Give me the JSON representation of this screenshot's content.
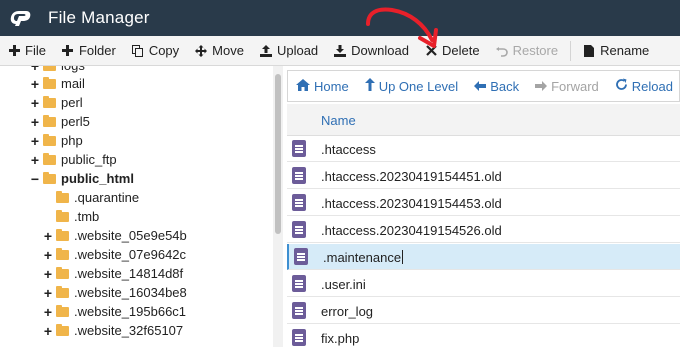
{
  "app": {
    "title": "File Manager",
    "logo_text": "cP"
  },
  "toolbar": {
    "file": "File",
    "folder": "Folder",
    "copy": "Copy",
    "move": "Move",
    "upload": "Upload",
    "download": "Download",
    "delete": "Delete",
    "restore": "Restore",
    "rename": "Rename"
  },
  "tree": {
    "items": [
      {
        "label": "logs",
        "type": "collapsed"
      },
      {
        "label": "mail",
        "type": "collapsed"
      },
      {
        "label": "perl",
        "type": "collapsed"
      },
      {
        "label": "perl5",
        "type": "collapsed"
      },
      {
        "label": "php",
        "type": "collapsed"
      },
      {
        "label": "public_ftp",
        "type": "collapsed"
      },
      {
        "label": "public_html",
        "type": "expanded"
      },
      {
        "label": ".quarantine",
        "type": "leaf"
      },
      {
        "label": ".tmb",
        "type": "leaf"
      },
      {
        "label": ".website_05e9e54b",
        "type": "collapsed"
      },
      {
        "label": ".website_07e9642c",
        "type": "collapsed"
      },
      {
        "label": ".website_14814d8f",
        "type": "collapsed"
      },
      {
        "label": ".website_16034be8",
        "type": "collapsed"
      },
      {
        "label": ".website_195b66c1",
        "type": "collapsed"
      },
      {
        "label": ".website_32f65107",
        "type": "collapsed"
      }
    ]
  },
  "nav": {
    "home": "Home",
    "up": "Up One Level",
    "back": "Back",
    "forward": "Forward",
    "reload": "Reload"
  },
  "table": {
    "header": "Name",
    "rows": [
      {
        "name": ".htaccess"
      },
      {
        "name": ".htaccess.20230419154451.old"
      },
      {
        "name": ".htaccess.20230419154453.old"
      },
      {
        "name": ".htaccess.20230419154526.old"
      },
      {
        "name": ".maintenance",
        "selected": true
      },
      {
        "name": ".user.ini"
      },
      {
        "name": "error_log"
      },
      {
        "name": "fix.php"
      }
    ]
  },
  "colors": {
    "header_bg": "#293a4a",
    "accent_blue": "#2f6fb4",
    "folder": "#f0b54a",
    "file_icon": "#6c5c99",
    "selected_row": "#d6ebf8",
    "annotation_arrow": "#e8202a"
  },
  "icons": {
    "file": "plus-icon",
    "folder": "plus-icon",
    "copy": "copy-icon",
    "move": "move-arrows-icon",
    "upload": "upload-icon",
    "download": "download-icon",
    "delete": "x-icon",
    "restore": "undo-icon",
    "rename": "document-icon",
    "home": "home-icon",
    "up": "up-arrow-icon",
    "back": "left-arrow-icon",
    "forward": "right-arrow-icon",
    "reload": "refresh-icon"
  }
}
